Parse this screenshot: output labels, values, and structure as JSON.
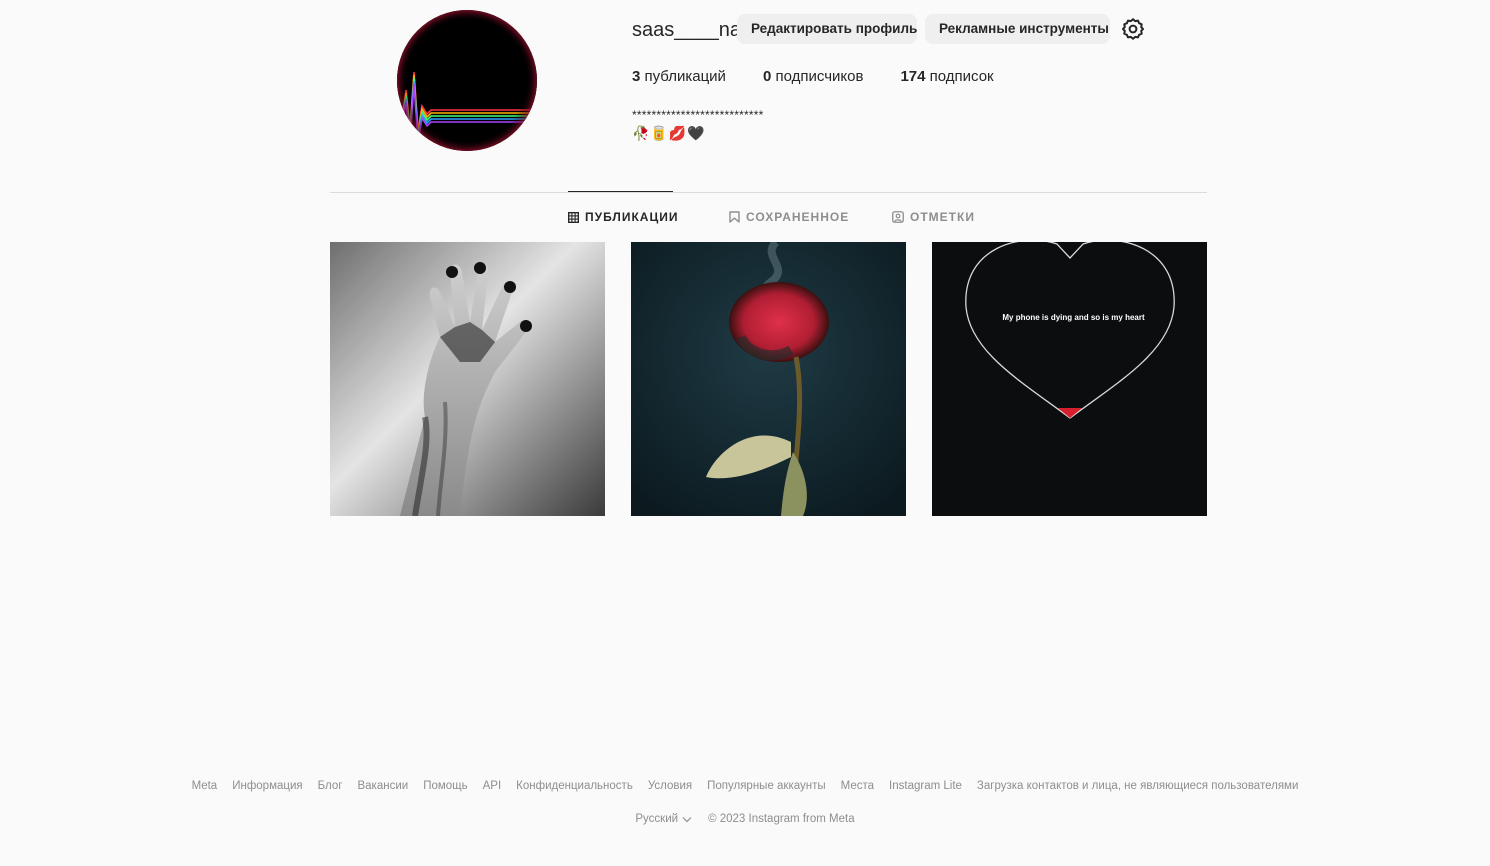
{
  "profile": {
    "username": "saas____na",
    "edit_button": "Редактировать профиль",
    "ads_button": "Рекламные инструменты",
    "settings_icon": "gear-icon",
    "stats": {
      "posts_count": "3",
      "posts_label": "публикаций",
      "followers_count": "0",
      "followers_label": "подписчиков",
      "following_count": "174",
      "following_label": "подписок"
    },
    "bio_line": "***************************",
    "bio_emoji": "🥀🥫💋🖤"
  },
  "tabs": [
    {
      "label": "ПУБЛИКАЦИИ",
      "icon": "grid-icon",
      "active": true
    },
    {
      "label": "СОХРАНЕННОЕ",
      "icon": "bookmark-icon",
      "active": false
    },
    {
      "label": "ОТМЕТКИ",
      "icon": "tagged-person-icon",
      "active": false
    }
  ],
  "posts": [
    {
      "description": "black-and-white hand with dark paint"
    },
    {
      "description": "burning red rose on dark teal background"
    },
    {
      "caption": "My phone is dying and so is my heart"
    }
  ],
  "footer": {
    "links": [
      "Meta",
      "Информация",
      "Блог",
      "Вакансии",
      "Помощь",
      "API",
      "Конфиденциальность",
      "Условия",
      "Популярные аккаунты",
      "Места",
      "Instagram Lite",
      "Загрузка контактов и лица, не являющиеся пользователями"
    ],
    "language": "Русский",
    "copyright": "© 2023 Instagram from Meta"
  },
  "colors": {
    "background": "#fafafa",
    "button_bg": "#efefef",
    "text": "#262626",
    "muted": "#8e8e8e",
    "divider": "#dbdbdb"
  }
}
